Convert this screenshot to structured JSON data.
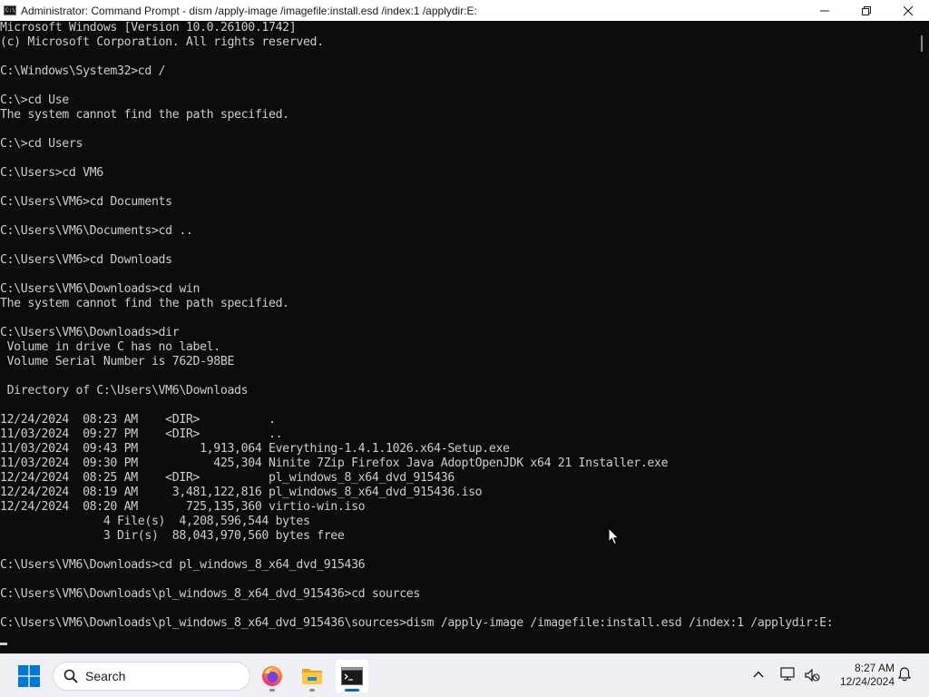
{
  "window": {
    "title": "Administrator: Command Prompt - dism  /apply-image /imagefile:install.esd /index:1 /applydir:E:",
    "app_icon_text": "C:\\"
  },
  "console": {
    "lines": [
      "Microsoft Windows [Version 10.0.26100.1742]",
      "(c) Microsoft Corporation. All rights reserved.",
      "",
      "C:\\Windows\\System32>cd /",
      "",
      "C:\\>cd Use",
      "The system cannot find the path specified.",
      "",
      "C:\\>cd Users",
      "",
      "C:\\Users>cd VM6",
      "",
      "C:\\Users\\VM6>cd Documents",
      "",
      "C:\\Users\\VM6\\Documents>cd ..",
      "",
      "C:\\Users\\VM6>cd Downloads",
      "",
      "C:\\Users\\VM6\\Downloads>cd win",
      "The system cannot find the path specified.",
      "",
      "C:\\Users\\VM6\\Downloads>dir",
      " Volume in drive C has no label.",
      " Volume Serial Number is 762D-98BE",
      "",
      " Directory of C:\\Users\\VM6\\Downloads",
      "",
      "12/24/2024  08:23 AM    <DIR>          .",
      "11/03/2024  09:27 PM    <DIR>          ..",
      "11/03/2024  09:43 PM         1,913,064 Everything-1.4.1.1026.x64-Setup.exe",
      "11/03/2024  09:30 PM           425,304 Ninite 7Zip Firefox Java AdoptOpenJDK x64 21 Installer.exe",
      "12/24/2024  08:25 AM    <DIR>          pl_windows_8_x64_dvd_915436",
      "12/24/2024  08:19 AM     3,481,122,816 pl_windows_8_x64_dvd_915436.iso",
      "12/24/2024  08:20 AM       725,135,360 virtio-win.iso",
      "               4 File(s)  4,208,596,544 bytes",
      "               3 Dir(s)  88,043,970,560 bytes free",
      "",
      "C:\\Users\\VM6\\Downloads>cd pl_windows_8_x64_dvd_915436",
      "",
      "C:\\Users\\VM6\\Downloads\\pl_windows_8_x64_dvd_915436>cd sources",
      "",
      "C:\\Users\\VM6\\Downloads\\pl_windows_8_x64_dvd_915436\\sources>dism /apply-image /imagefile:install.esd /index:1 /applydir:E:"
    ]
  },
  "taskbar": {
    "search_label": "Search",
    "apps": [
      "firefox-icon",
      "file-explorer-icon",
      "command-prompt-icon"
    ],
    "clock_time": "8:27 AM",
    "clock_date": "12/24/2024"
  },
  "colors": {
    "console_bg": "#0c0c0c",
    "console_fg": "#cccccc",
    "taskbar_bg": "#eef0f5",
    "accent": "#0067c0"
  }
}
